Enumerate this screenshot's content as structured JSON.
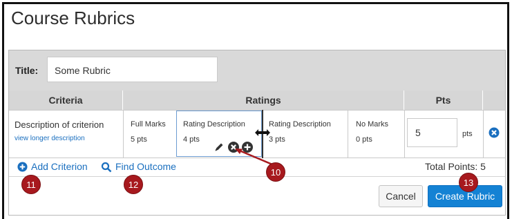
{
  "page": {
    "title": "Course Rubrics"
  },
  "rubric": {
    "title_label": "Title:",
    "title_value": "Some Rubric",
    "headers": {
      "criteria": "Criteria",
      "ratings": "Ratings",
      "pts": "Pts"
    },
    "criterion": {
      "description": "Description of criterion",
      "long_link": "view longer description",
      "ratings": [
        {
          "title": "Full Marks",
          "pts": "5 pts"
        },
        {
          "title": "Rating Description",
          "pts": "4 pts"
        },
        {
          "title": "Rating Description",
          "pts": "3 pts"
        },
        {
          "title": "No Marks",
          "pts": "0 pts"
        }
      ],
      "points_value": "5",
      "points_unit": "pts"
    },
    "actions": {
      "add_criterion": "Add Criterion",
      "find_outcome": "Find Outcome",
      "total_points": "Total Points: 5",
      "cancel": "Cancel",
      "create": "Create Rubric"
    }
  },
  "callouts": [
    "10",
    "11",
    "12",
    "13"
  ],
  "colors": {
    "link": "#1a6fbf",
    "primary_button": "#1482d4",
    "callout": "#a7191e",
    "header_bg": "#d6d6d6"
  },
  "icons": [
    "pencil-icon",
    "delete-circle-icon",
    "add-circle-icon",
    "resize-arrow-icon",
    "search-icon",
    "remove-circle-icon"
  ]
}
